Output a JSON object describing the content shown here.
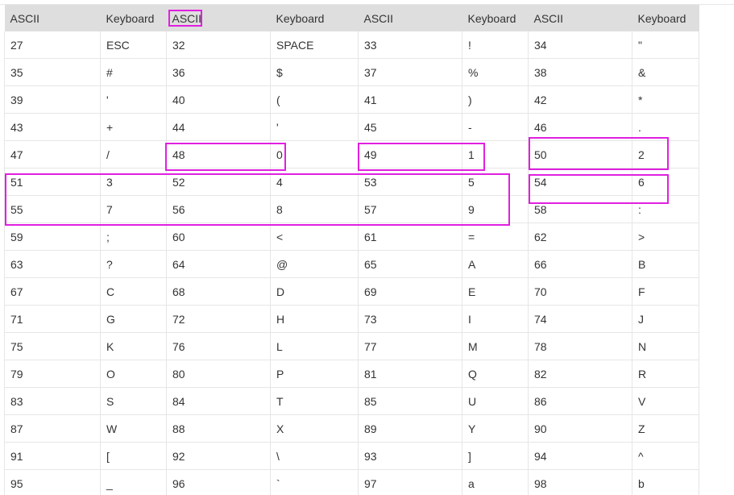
{
  "table": {
    "headers": [
      "ASCII",
      "Keyboard",
      "ASCII",
      "Keyboard",
      "ASCII",
      "Keyboard",
      "ASCII",
      "Keyboard"
    ],
    "rows": [
      [
        "27",
        "ESC",
        "32",
        "SPACE",
        "33",
        "!",
        "34",
        "\""
      ],
      [
        "35",
        "#",
        "36",
        "$",
        "37",
        "%",
        "38",
        "&"
      ],
      [
        "39",
        "'",
        "40",
        "(",
        "41",
        ")",
        "42",
        "*"
      ],
      [
        "43",
        "+",
        "44",
        "'",
        "45",
        "-",
        "46",
        "."
      ],
      [
        "47",
        "/",
        "48",
        "0",
        "49",
        "1",
        "50",
        "2"
      ],
      [
        "51",
        "3",
        "52",
        "4",
        "53",
        "5",
        "54",
        "6"
      ],
      [
        "55",
        "7",
        "56",
        "8",
        "57",
        "9",
        "58",
        ":"
      ],
      [
        "59",
        ";",
        "60",
        "<",
        "61",
        "=",
        "62",
        ">"
      ],
      [
        "63",
        "?",
        "64",
        "@",
        "65",
        "A",
        "66",
        "B"
      ],
      [
        "67",
        "C",
        "68",
        "D",
        "69",
        "E",
        "70",
        "F"
      ],
      [
        "71",
        "G",
        "72",
        "H",
        "73",
        "I",
        "74",
        "J"
      ],
      [
        "75",
        "K",
        "76",
        "L",
        "77",
        "M",
        "78",
        "N"
      ],
      [
        "79",
        "O",
        "80",
        "P",
        "81",
        "Q",
        "82",
        "R"
      ],
      [
        "83",
        "S",
        "84",
        "T",
        "85",
        "U",
        "86",
        "V"
      ],
      [
        "87",
        "W",
        "88",
        "X",
        "89",
        "Y",
        "90",
        "Z"
      ],
      [
        "91",
        "[",
        "92",
        "\\",
        "93",
        "]",
        "94",
        "^"
      ],
      [
        "95",
        "_",
        "96",
        "`",
        "97",
        "a",
        "98",
        "b"
      ]
    ]
  },
  "highlight_color": "#e020e0"
}
